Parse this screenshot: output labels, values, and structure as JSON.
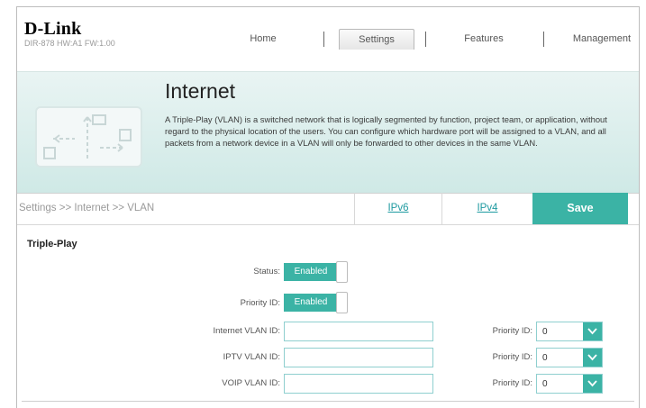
{
  "brand": {
    "logo": "D-Link",
    "model": "DIR-878 HW:A1 FW:1.00"
  },
  "nav": {
    "items": [
      {
        "label": "Home"
      },
      {
        "label": "Settings"
      },
      {
        "label": "Features"
      },
      {
        "label": "Management"
      }
    ],
    "active": "Settings"
  },
  "banner": {
    "title": "Internet",
    "description": "A Triple-Play (VLAN) is a switched network that is logically segmented by function, project team, or application, without regard to the physical location of the users. You can configure which hardware port will be assigned to a VLAN, and all packets from a network device in a VLAN will only be forwarded to other devices in the same VLAN."
  },
  "breadcrumb": "Settings >> Internet >> VLAN",
  "tabs": {
    "ipv6": "IPv6",
    "ipv4": "IPv4"
  },
  "save_label": "Save",
  "triple_play": {
    "title": "Triple-Play",
    "status_label": "Status:",
    "status_value": "Enabled",
    "priority_label": "Priority ID:",
    "priority_value": "Enabled",
    "rows": [
      {
        "label": "Internet VLAN ID:",
        "value": "",
        "priority_label": "Priority ID:",
        "priority": "0"
      },
      {
        "label": "IPTV VLAN ID:",
        "value": "",
        "priority_label": "Priority ID:",
        "priority": "0"
      },
      {
        "label": "VOIP VLAN ID:",
        "value": "",
        "priority_label": "Priority ID:",
        "priority": "0"
      }
    ]
  },
  "colors": {
    "accent": "#3bb3a5",
    "link": "#1e9aa0"
  }
}
